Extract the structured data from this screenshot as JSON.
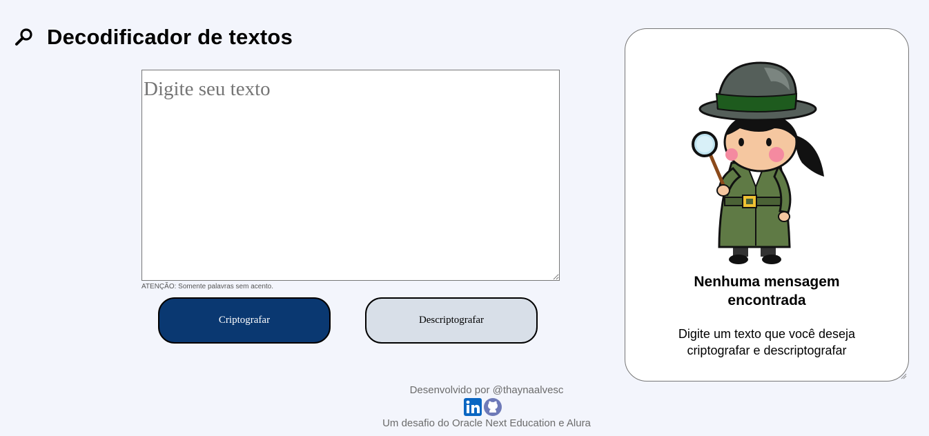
{
  "header": {
    "title": "Decodificador de textos",
    "logo_icon": "magnifier-icon"
  },
  "input": {
    "placeholder": "Digite seu texto",
    "value": ""
  },
  "warning": "ATENÇÃO: Somente palavras sem acento.",
  "buttons": {
    "encrypt_label": "Criptografar",
    "decrypt_label": "Descriptografar"
  },
  "result": {
    "illustration": "detective-illustration",
    "empty_title": "Nenhuma mensagem encontrada",
    "empty_subtitle": "Digite um texto que você deseja criptografar e descriptografar"
  },
  "footer": {
    "developed_by": "Desenvolvido por @thaynaalvesc",
    "social_icons": [
      "linkedin-icon",
      "github-icon"
    ],
    "challenge": "Um desafio do Oracle Next Education e Alura"
  },
  "colors": {
    "background": "#f3f5fc",
    "primary_button": "#0a3871",
    "secondary_button": "#d8dfe8",
    "linkedin": "#0a66c2",
    "github": "#6e7ab8"
  }
}
